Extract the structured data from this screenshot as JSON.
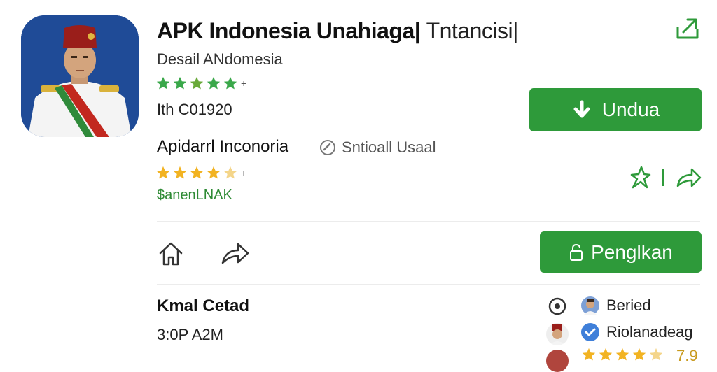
{
  "app": {
    "title_main": "APK Indonesia Unahiaga|",
    "title_extra": "Tntancisi|",
    "subtitle": "Desail ANdomesia",
    "rating_plus": "+",
    "size": "Ith C01920",
    "install_label": "Undua"
  },
  "developer": {
    "name": "Apidarrl Inconoria",
    "badge_label": "Sntioall Usaal",
    "rating_plus": "+",
    "price": "$anenLNAK"
  },
  "actions": {
    "primary_label": "Penglkan"
  },
  "section": {
    "title": "Kmal Cetad",
    "time": "3:0P A2M"
  },
  "side_list": [
    {
      "label": "Beried"
    },
    {
      "label": "Riolanadeag"
    },
    {
      "label": "7.9"
    }
  ],
  "colors": {
    "accent": "#2e9a3a",
    "star_green": "#3aa84a",
    "star_gold": "#f2b322"
  }
}
